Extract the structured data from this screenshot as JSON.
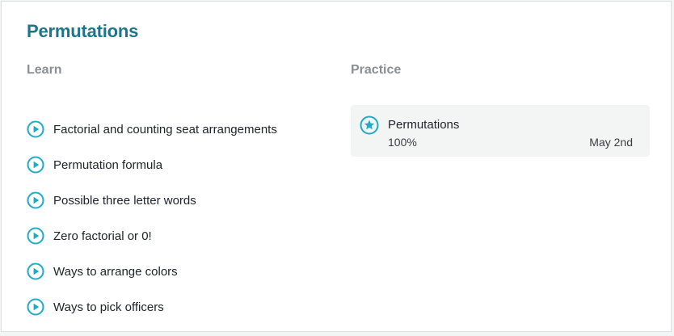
{
  "unit": {
    "title": "Permutations"
  },
  "learn": {
    "heading": "Learn",
    "lessons": [
      {
        "label": "Factorial and counting seat arrangements",
        "icon": "play-icon"
      },
      {
        "label": "Permutation formula",
        "icon": "play-icon"
      },
      {
        "label": "Possible three letter words",
        "icon": "play-icon"
      },
      {
        "label": "Zero factorial or 0!",
        "icon": "play-icon"
      },
      {
        "label": "Ways to arrange colors",
        "icon": "play-icon"
      },
      {
        "label": "Ways to pick officers",
        "icon": "play-icon"
      }
    ]
  },
  "practice": {
    "heading": "Practice",
    "items": [
      {
        "name": "Permutations",
        "progress": "100%",
        "date": "May 2nd",
        "icon": "star-icon"
      }
    ]
  },
  "colors": {
    "title": "#1c7688",
    "accent": "#1fabc4",
    "muted_heading": "#898f94",
    "practice_background": "#f3f4f4"
  }
}
